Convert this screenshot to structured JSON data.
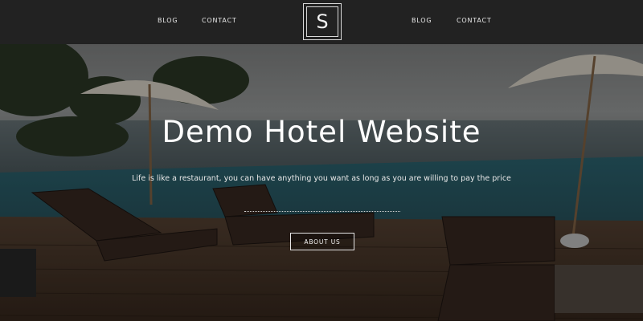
{
  "header": {
    "nav_left": [
      {
        "label": "BLOG"
      },
      {
        "label": "CONTACT"
      }
    ],
    "logo_letter": "S",
    "nav_right": [
      {
        "label": "BLOG"
      },
      {
        "label": "CONTACT"
      }
    ]
  },
  "hero": {
    "title": "Demo Hotel Website",
    "tagline": "Life is like a restaurant, you can have anything you want as long as you are willing to pay the price",
    "button_label": "ABOUT US"
  },
  "colors": {
    "header_bg": "#222222",
    "text": "#ffffff",
    "overlay": "#000000"
  }
}
